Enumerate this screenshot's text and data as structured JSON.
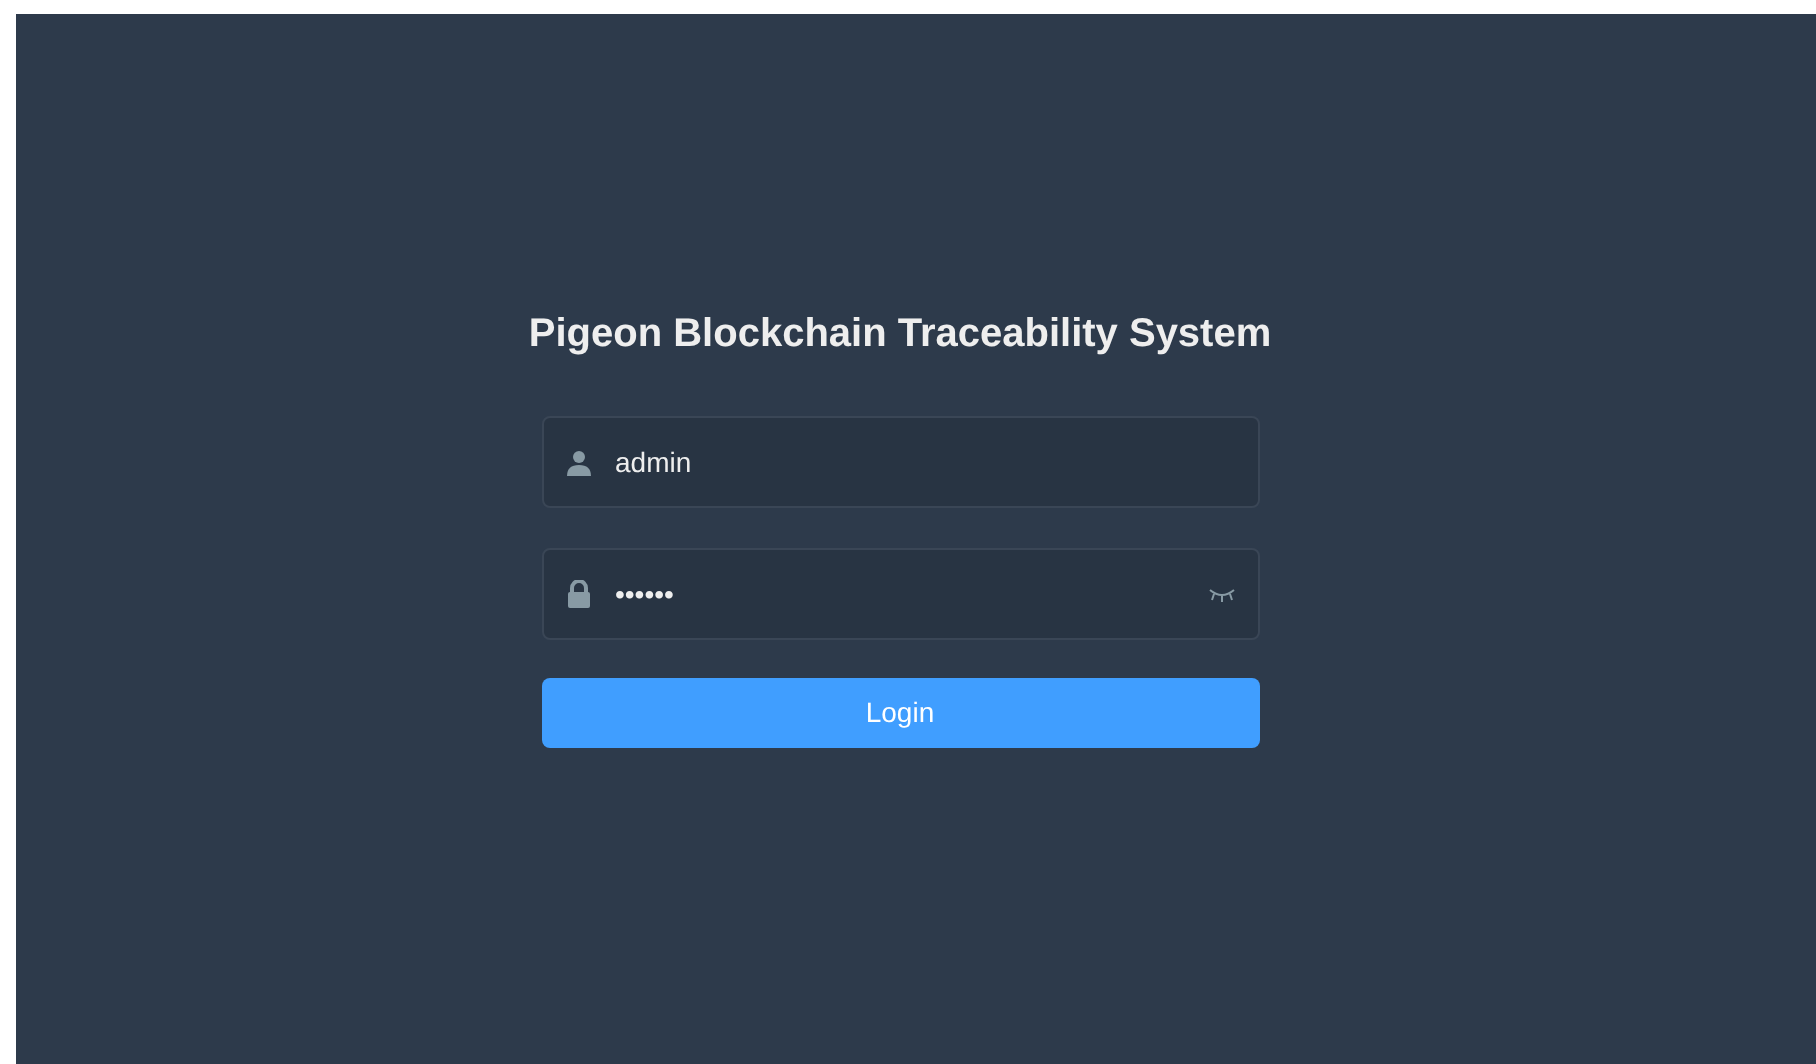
{
  "title": "Pigeon Blockchain Traceability System",
  "username": {
    "value": "admin"
  },
  "password": {
    "value": "••••••",
    "shown": false
  },
  "login_button": {
    "label": "Login"
  }
}
